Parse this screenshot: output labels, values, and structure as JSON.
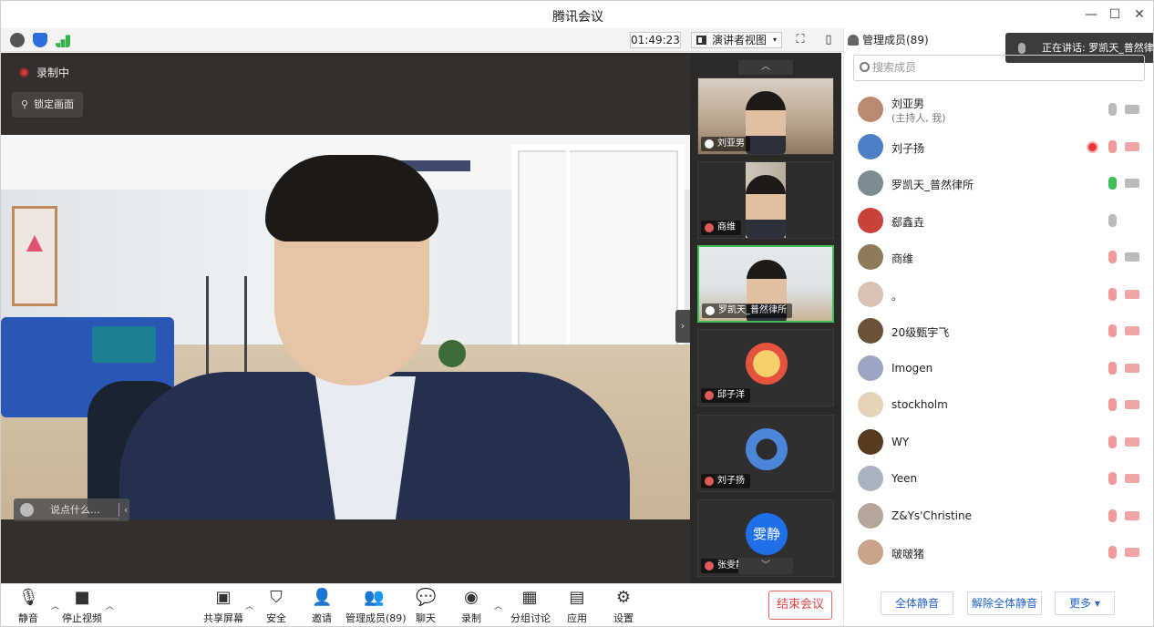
{
  "window": {
    "title": "腾讯会议",
    "min": "—",
    "max": "☐",
    "close": "✕"
  },
  "toolbar": {
    "timer": "01:49:23",
    "view_label": "演讲者视图",
    "view_caret": "▾",
    "fullscreen": "⛶",
    "sidebar": "▯"
  },
  "main": {
    "recording": "录制中",
    "lock_view": "锁定画面",
    "chat_placeholder": "说点什么..."
  },
  "thumbnails": [
    {
      "name": "刘亚男",
      "kind": "video",
      "active": false
    },
    {
      "name": "商维",
      "kind": "video",
      "active": false
    },
    {
      "name": "罗凯天_普然律所",
      "kind": "video",
      "active": true
    },
    {
      "name": "邱子洋",
      "kind": "avatar",
      "active": false
    },
    {
      "name": "刘子扬",
      "kind": "avatar",
      "active": false
    },
    {
      "name": "张雯静",
      "kind": "text-avatar",
      "avatar_text": "雯静",
      "active": false
    }
  ],
  "bottom": {
    "mute": "静音",
    "stop_video": "停止视频",
    "share": "共享屏幕",
    "security": "安全",
    "invite": "邀请",
    "members": "管理成员(89)",
    "chat": "聊天",
    "record": "录制",
    "breakout": "分组讨论",
    "apps": "应用",
    "settings": "设置",
    "end": "结束会议"
  },
  "panel": {
    "header": "管理成员(89)",
    "speaking": "正在讲话: 罗凯天_普然律所",
    "search_placeholder": "搜索成员",
    "members": [
      {
        "name": "刘亚男",
        "sub": "(主持人, 我)",
        "mic": "on-gray",
        "cam": "on",
        "rec": false,
        "color": "#b98a6e"
      },
      {
        "name": "刘子扬",
        "mic": "off",
        "cam": "off",
        "rec": true,
        "color": "#4d7fc6"
      },
      {
        "name": "罗凯天_普然律所",
        "mic": "on-green",
        "cam": "on",
        "rec": false,
        "color": "#7d8b92"
      },
      {
        "name": "郄鑫垚",
        "mic": "on-gray",
        "cam": "none",
        "rec": false,
        "color": "#c9423a"
      },
      {
        "name": "商维",
        "mic": "off",
        "cam": "on",
        "rec": false,
        "color": "#8f7a5a"
      },
      {
        "name": "。",
        "mic": "off",
        "cam": "off",
        "rec": false,
        "color": "#d8c2b4"
      },
      {
        "name": "20级甄宇飞",
        "mic": "off",
        "cam": "off",
        "rec": false,
        "color": "#6a5237"
      },
      {
        "name": "Imogen",
        "mic": "off",
        "cam": "off",
        "rec": false,
        "color": "#9aa6c4"
      },
      {
        "name": "stockholm",
        "mic": "off",
        "cam": "off",
        "rec": false,
        "color": "#e5d3b8"
      },
      {
        "name": "WY",
        "mic": "off",
        "cam": "off",
        "rec": false,
        "color": "#5a3a1e"
      },
      {
        "name": "Yeen",
        "mic": "off",
        "cam": "off",
        "rec": false,
        "color": "#a9b2bf"
      },
      {
        "name": "Z&Ys'Christine",
        "mic": "off",
        "cam": "off",
        "rec": false,
        "color": "#b4a79a"
      },
      {
        "name": "啵啵猪",
        "mic": "off",
        "cam": "off",
        "rec": false,
        "color": "#caa38a"
      }
    ],
    "mute_all": "全体静音",
    "unmute_all": "解除全体静音",
    "more": "更多 ▾"
  },
  "colors": {
    "accent": "#2364d1",
    "end": "#e04545",
    "active_border": "#3fbf5a",
    "mic_green": "#3fbf5a",
    "muted": "#e05a5a"
  }
}
